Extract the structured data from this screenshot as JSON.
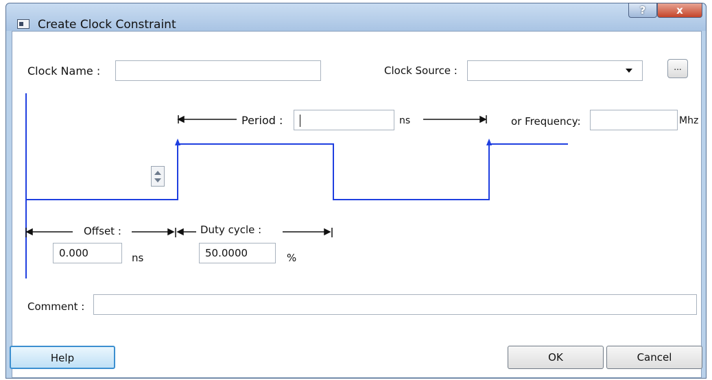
{
  "window": {
    "title": "Create Clock Constraint",
    "help_glyph": "?",
    "close_glyph": "x"
  },
  "form": {
    "clock_name_label": "Clock Name :",
    "clock_name_value": "",
    "clock_source_label": "Clock Source :",
    "clock_source_value": "",
    "browse_label": "...",
    "period_label": "Period :",
    "period_value": "",
    "period_unit": "ns",
    "frequency_label": "or Frequency:",
    "frequency_value": "",
    "frequency_unit": "Mhz",
    "offset_label": "Offset :",
    "offset_value": "0.000",
    "offset_unit": "ns",
    "duty_cycle_label": "Duty cycle :",
    "duty_cycle_value": "50.0000",
    "duty_cycle_unit": "%",
    "comment_label": "Comment :",
    "comment_value": ""
  },
  "buttons": {
    "help": "Help",
    "ok": "OK",
    "cancel": "Cancel"
  },
  "colors": {
    "waveform": "#1f3fe0",
    "title_bar": "#b9d1ea",
    "close_button": "#c4442a"
  },
  "icons": {
    "app": "app-window-icon",
    "dropdown": "chevron-down-icon",
    "spinner": "spinner-updown-icon"
  }
}
